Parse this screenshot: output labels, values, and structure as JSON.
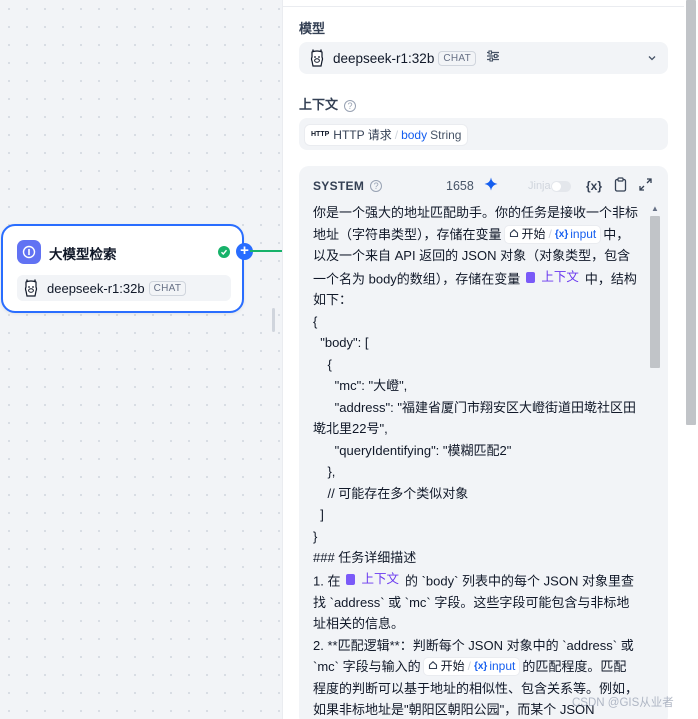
{
  "workflow_node": {
    "title": "大模型检索",
    "model_name": "deepseek-r1:32b",
    "model_badge": "CHAT"
  },
  "panel": {
    "model_label": "模型",
    "model_name": "deepseek-r1:32b",
    "model_badge": "CHAT",
    "context_label": "上下文",
    "context_help": "?",
    "context_chip": {
      "icon_text": "HTTP",
      "node": "HTTP 请求",
      "separator": "/",
      "field": "body",
      "type": "String"
    },
    "prompt": {
      "role": "SYSTEM",
      "help": "?",
      "token_count": "1658",
      "jinja_label": "Jinja",
      "var_icon": "{x}",
      "lines": {
        "l1": "你是一个强大的地址匹配助手。你的任务是接收一个非标地址（字符串类型），存储在变量",
        "l2a": "中，以及一个来自 API 返回的 JSON 对象（对象类型，包含一个名为 body的数组），存储在变量",
        "l2b": "中，结构如下：",
        "json": "{\n  \"body\": [\n    {\n      \"mc\": \"大嶝\",\n      \"address\": \"福建省厦门市翔安区大嶝街道田墘社区田墘北里22号\",\n      \"queryIdentifying\": \"模糊匹配2\"\n    },\n    // 可能存在多个类似对象\n  ]\n}\n### 任务详细描述",
        "l3a": "1. 在",
        "l3b": "的 `body` 列表中的每个 JSON 对象里查找 `address` 或 `mc` 字段。这些字段可能包含与非标地址相关的信息。",
        "l4a": "2. **匹配逻辑**：判断每个 JSON 对象中的 `address` 或 `mc` 字段与输入的",
        "l4b": "的匹配程度。匹配程度的判断可以基于地址的相似性、包含关系等。例如，如果非标地址是\"朝阳区朝阳公园\"，而某个 JSON"
      },
      "var_start": {
        "node": "开始",
        "separator": "/",
        "var": "input"
      },
      "ctx_var": "上下文"
    }
  },
  "watermark": "CSDN @GIS从业者",
  "colors": {
    "primary": "#296dff",
    "success": "#17b26a",
    "node_icon": "#6172f3",
    "context_var": "#6938ef",
    "variable": "#155eef"
  }
}
